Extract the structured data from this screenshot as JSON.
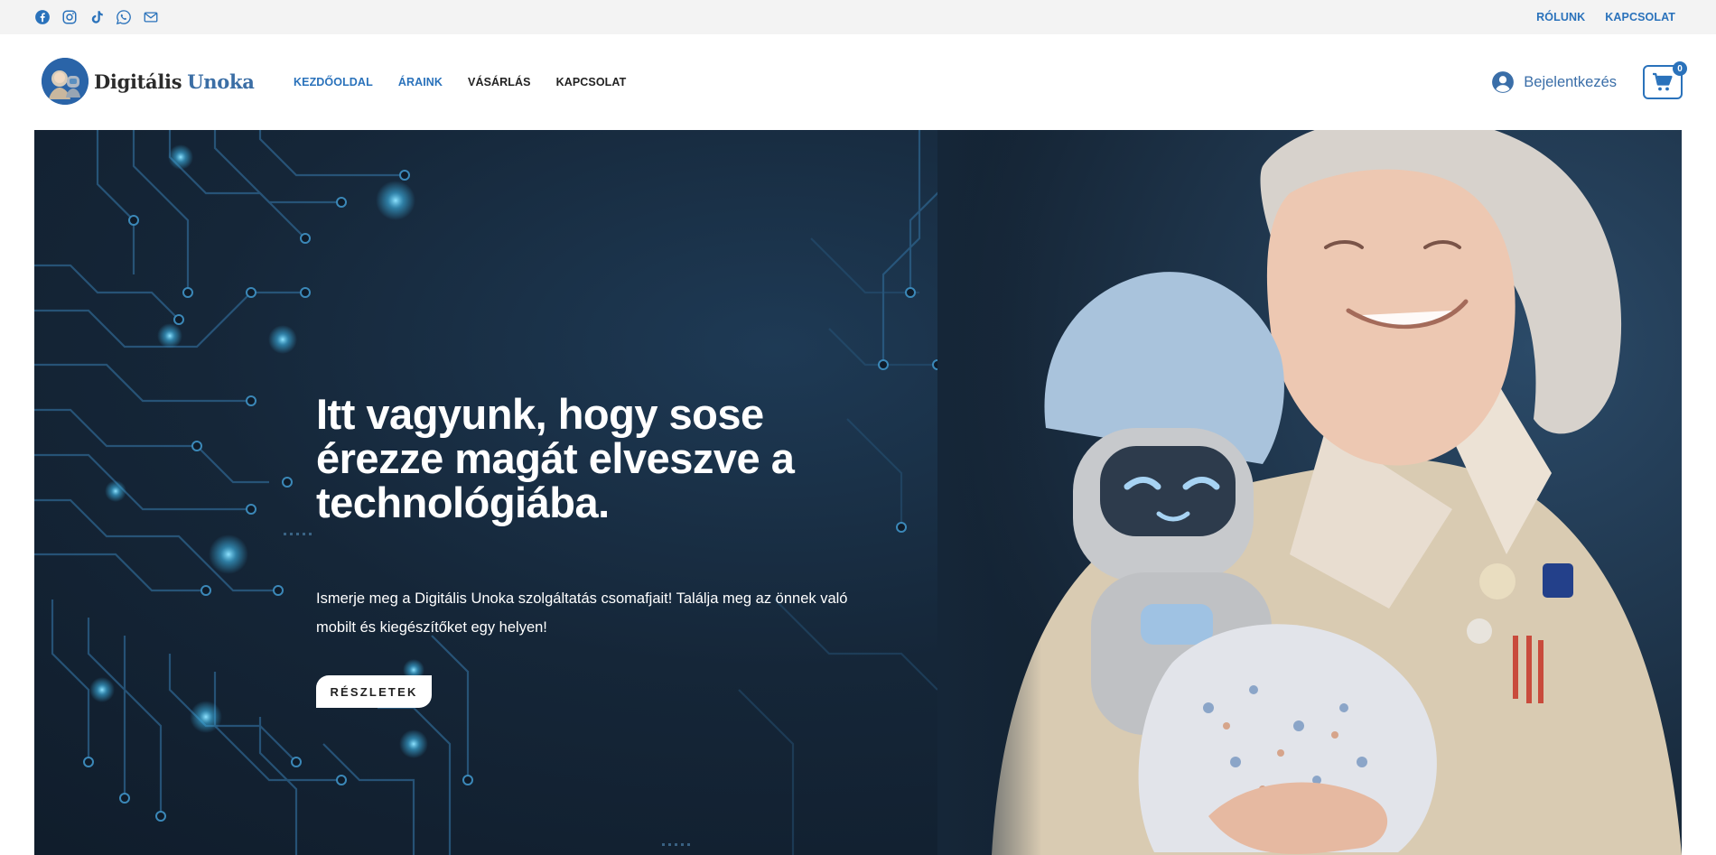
{
  "topbar": {
    "social_icons": [
      "facebook-icon",
      "instagram-icon",
      "tiktok-icon",
      "whatsapp-icon",
      "mail-icon"
    ],
    "links": [
      "RÓLUNK",
      "KAPCSOLAT"
    ]
  },
  "header": {
    "logo": {
      "word1": "Digitális",
      "word2": "Unoka"
    },
    "nav": [
      "KEZDŐOLDAL",
      "ÁRAINK",
      "VÁSÁRLÁS",
      "KAPCSOLAT"
    ],
    "active_nav": "KEZDŐOLDAL",
    "login_label": "Bejelentkezés",
    "cart_count": "0"
  },
  "hero": {
    "title": "Itt vagyunk, hogy sose érezze magát elveszve a technológiába.",
    "text": "Ismerje meg a Digitális Unoka szolgáltatás csomafjait! Találja meg az önnek való mobilt és kiegészítőket egy helyen!",
    "button_label": "RÉSZLETEK"
  },
  "colors": {
    "accent": "#2a72bb",
    "topbar_bg": "#f3f3f3",
    "hero_bg": "#152638",
    "circuit_glow": "#3fb6e8"
  }
}
